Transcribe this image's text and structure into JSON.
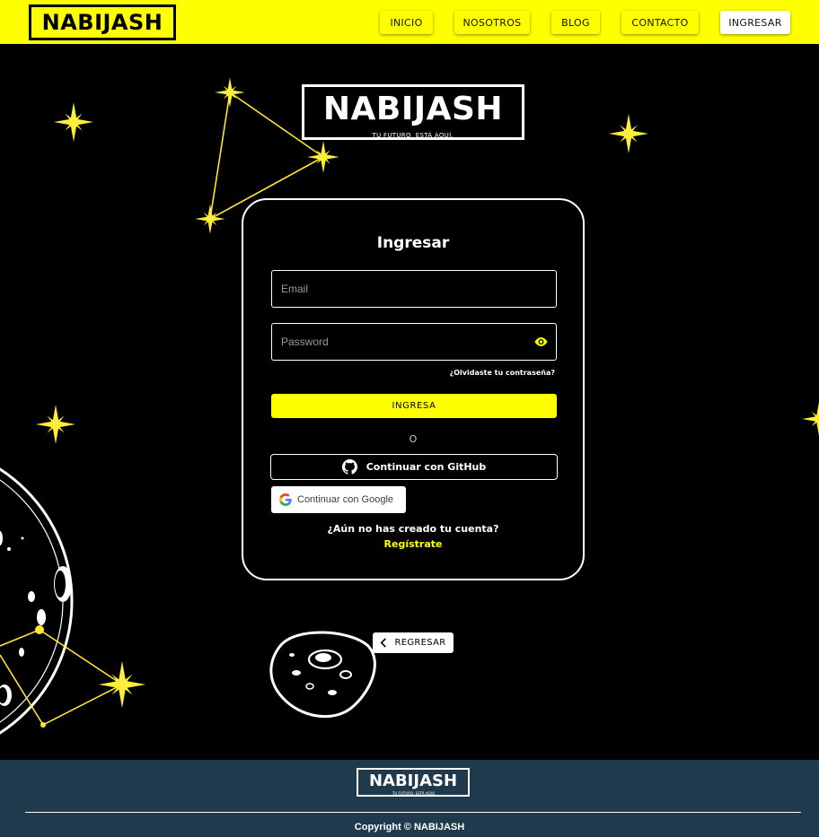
{
  "brand": {
    "name": "NABIJASH",
    "tagline": "TU FUTURO, ESTÁ AQUÍ.",
    "accent_color": "#ffff00",
    "footer_color": "#1e3a4c"
  },
  "nav": {
    "items": [
      {
        "label": "INICIO"
      },
      {
        "label": "NOSOTROS"
      },
      {
        "label": "BLOG"
      },
      {
        "label": "CONTACTO"
      },
      {
        "label": "INGRESAR",
        "active": true
      }
    ]
  },
  "login": {
    "title": "Ingresar",
    "email": {
      "placeholder": "Email",
      "value": ""
    },
    "password": {
      "placeholder": "Password",
      "value": "",
      "icon": "eye-icon"
    },
    "forgot_link": "¿Olvidaste tu contraseña?",
    "submit_label": "INGRESA",
    "separator": "O",
    "github_label": "Continuar con GitHub",
    "github_icon": "github-icon",
    "google_label": "Continuar con Google",
    "google_icon": "google-icon",
    "no_account_text": "¿Aún no has creado tu cuenta?",
    "register_link": "Regístrate"
  },
  "back_button": {
    "label": "REGRESAR",
    "icon": "chevron-left-icon"
  },
  "footer": {
    "copyright": "Copyright © NABIJASH"
  }
}
